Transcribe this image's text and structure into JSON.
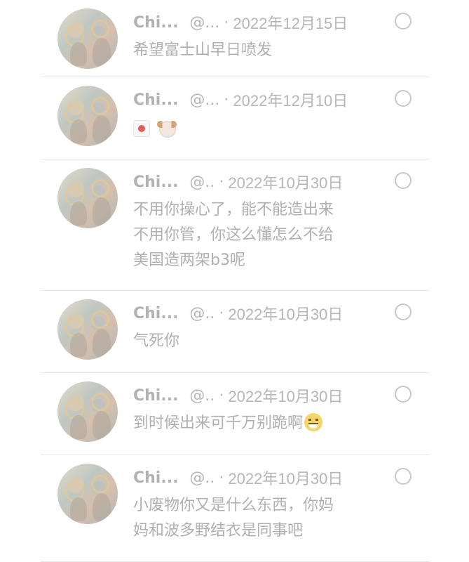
{
  "posts": [
    {
      "name": "Chi...",
      "handle": "@...",
      "dot": "·",
      "date": "2022年12月15日",
      "text": "希望富士山早日喷发"
    },
    {
      "name": "Chi...",
      "handle": "@...",
      "dot": "·",
      "date": "2022年12月10日",
      "emoji": [
        "japan-flag",
        "dog-face"
      ]
    },
    {
      "name": "Chi...",
      "handle": "@..",
      "dot": "·",
      "date": "2022年10月30日",
      "text": "不用你操心了，能不能造出来\n不用你管，你这么懂怎么不给\n美国造两架b3呢"
    },
    {
      "name": "Chi...",
      "handle": "@..",
      "dot": "·",
      "date": "2022年10月30日",
      "text": "气死你"
    },
    {
      "name": "Chi...",
      "handle": "@..",
      "dot": "·",
      "date": "2022年10月30日",
      "text": "到时候出来可千万别跪啊",
      "emoji_inline": "grinning-face"
    },
    {
      "name": "Chi...",
      "handle": "@..",
      "dot": "·",
      "date": "2022年10月30日",
      "text": "小废物你又是什么东西，你妈\n妈和波多野结衣是同事吧"
    }
  ],
  "icons": {
    "more": "circle-outline-icon"
  },
  "colors": {
    "text": "#b0b0b0",
    "meta": "#b6b6b6",
    "divider": "#e9e9e9",
    "background": "#ffffff"
  }
}
